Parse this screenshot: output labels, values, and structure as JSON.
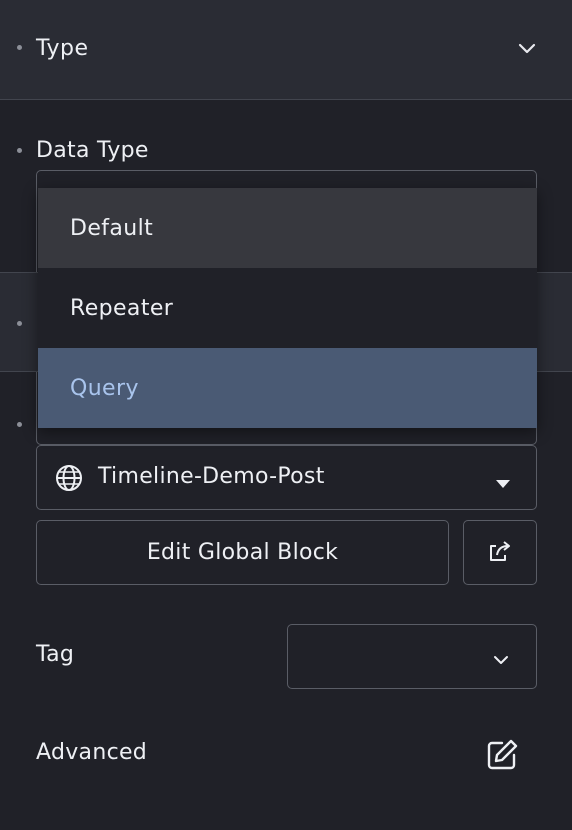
{
  "type_section": {
    "title": "Type"
  },
  "data_type": {
    "label": "Data Type",
    "options": [
      "Default",
      "Repeater",
      "Query"
    ],
    "hovered": "Default",
    "selected": "Query"
  },
  "global_block": {
    "selected": "Timeline-Demo-Post",
    "edit_label": "Edit Global Block"
  },
  "tag": {
    "label": "Tag",
    "value": ""
  },
  "advanced": {
    "label": "Advanced"
  },
  "icons": {
    "type_chevron": "chevron-down-icon",
    "globe": "globe-icon",
    "select_caret": "caret-down-icon",
    "open_external": "external-link-icon",
    "tag_chevron": "chevron-down-icon",
    "edit": "edit-icon"
  }
}
